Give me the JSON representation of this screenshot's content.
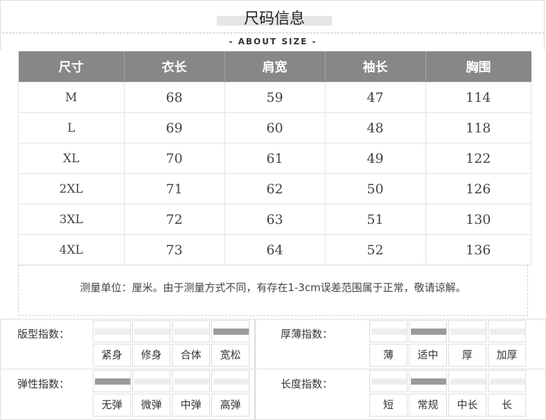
{
  "header": {
    "title": "尺码信息",
    "subtitle": "- ABOUT SIZE -"
  },
  "table": {
    "columns": [
      "尺寸",
      "衣长",
      "肩宽",
      "袖长",
      "胸围"
    ],
    "rows": [
      [
        "M",
        "68",
        "59",
        "47",
        "114"
      ],
      [
        "L",
        "69",
        "60",
        "48",
        "118"
      ],
      [
        "XL",
        "70",
        "61",
        "49",
        "122"
      ],
      [
        "2XL",
        "71",
        "62",
        "50",
        "126"
      ],
      [
        "3XL",
        "72",
        "63",
        "51",
        "130"
      ],
      [
        "4XL",
        "73",
        "64",
        "52",
        "136"
      ]
    ]
  },
  "note": "测量单位：厘米。由于测量方式不同，有存在1-3cm误差范围属于正常，敬请谅解。",
  "indices": [
    {
      "label": "版型指数：",
      "options": [
        "紧身",
        "修身",
        "合体",
        "宽松"
      ],
      "selected_index": 3
    },
    {
      "label": "厚薄指数：",
      "options": [
        "薄",
        "适中",
        "厚",
        "加厚"
      ],
      "selected_index": 1
    },
    {
      "label": "弹性指数：",
      "options": [
        "无弹",
        "微弹",
        "中弹",
        "高弹"
      ],
      "selected_index": 0
    },
    {
      "label": "长度指数：",
      "options": [
        "短",
        "常规",
        "中长",
        "长"
      ],
      "selected_index": 1
    }
  ]
}
